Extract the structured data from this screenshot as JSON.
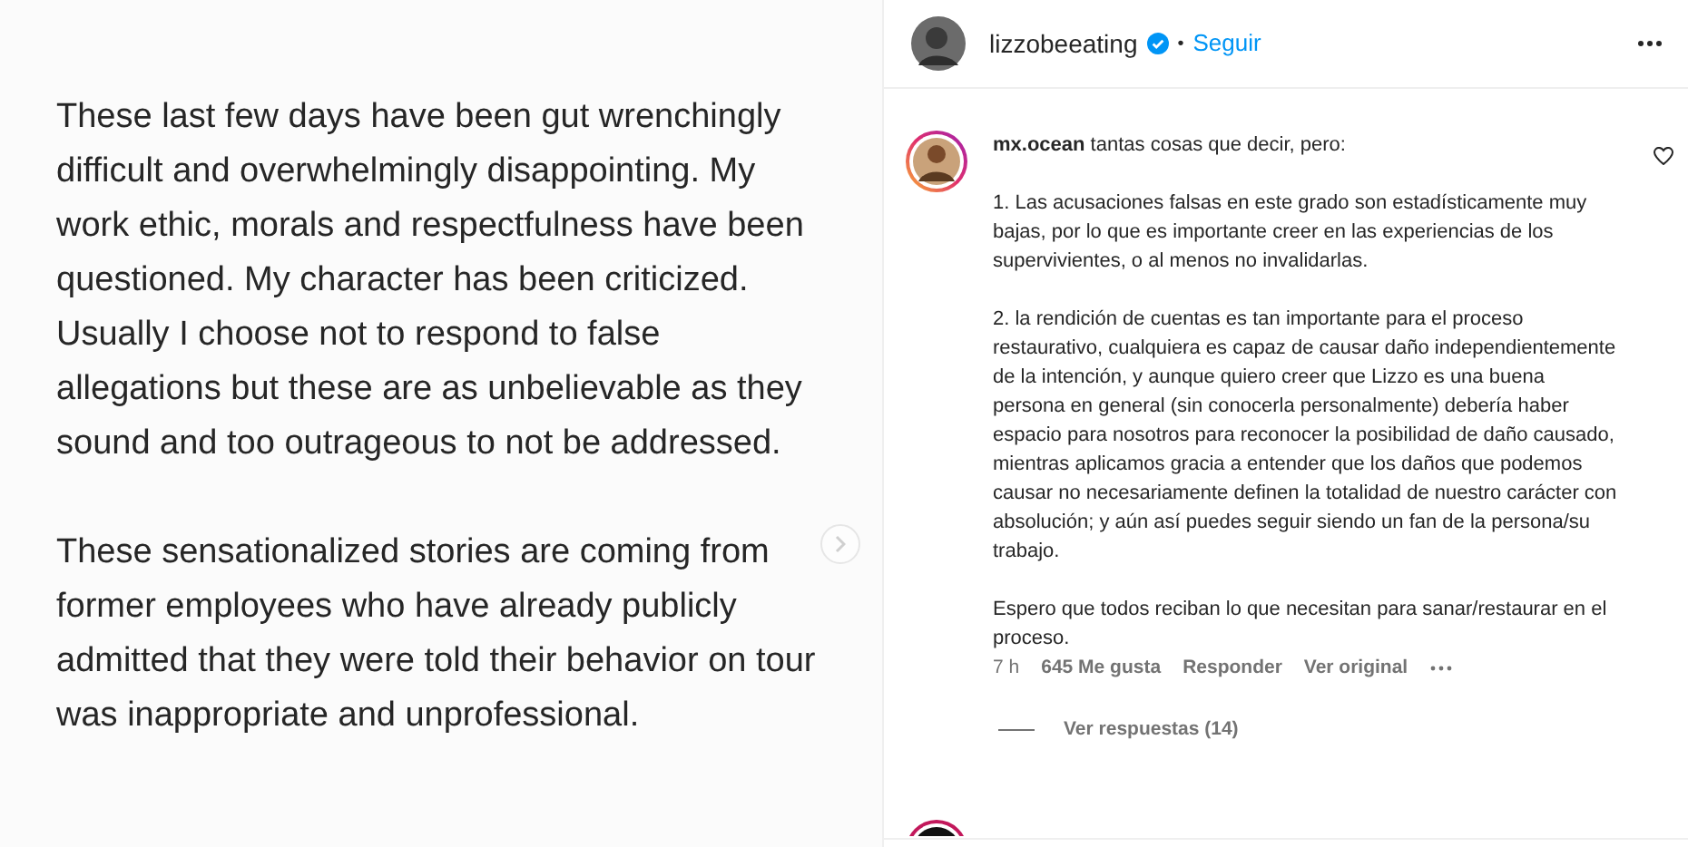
{
  "post_image": {
    "paragraphs": [
      "These last few days have been gut wrenchingly difficult and overwhelmingly disappointing. My work ethic, morals and respectfulness have been questioned. My character has been criticized. Usually I choose not to respond to false allegations but these are as unbelievable as they sound and too outrageous to not be addressed.",
      "These sensationalized stories are coming from former employees who have already publicly admitted that they were told their behavior on tour was inappropriate and unprofessional."
    ]
  },
  "header": {
    "username": "lizzobeeating",
    "verified": true,
    "separator": "•",
    "follow": "Seguir"
  },
  "comment": {
    "first_line": "**mx.ocean** tantas cosas que decir, pero:",
    "liked": false,
    "paragraphs": [
      "1. Las acusaciones falsas en este grado son estadísticamente muy bajas, por lo que es importante creer en las experiencias de los supervivientes, o al menos no invalidarlas.",
      "2. la rendición de cuentas es tan importante para el proceso restaurativo, cualquiera es capaz de causar daño independientemente de la intención, y aunque quiero creer que Lizzo es una buena persona en general (sin conocerla personalmente) debería haber espacio para nosotros para reconocer la posibilidad de daño causado, mientras aplicamos gracia a entender que los daños que podemos causar no necesariamente definen la totalidad de nuestro carácter con absolución; y aún así puedes seguir siendo un fan de la persona/su trabajo.",
      "Espero que todos reciban lo que necesitan para sanar/restaurar en el proceso."
    ],
    "time": "7 h",
    "likes": "645 Me gusta",
    "reply": "Responder",
    "see_original": "Ver original",
    "view_replies": "Ver respuestas (14)"
  }
}
